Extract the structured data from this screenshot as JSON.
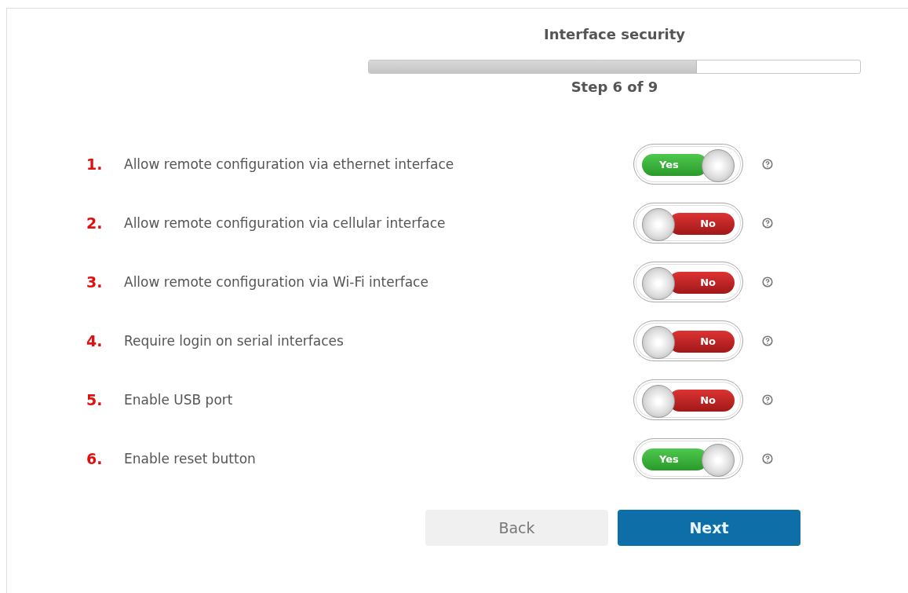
{
  "wizard": {
    "title": "Interface security",
    "progress": {
      "level": 0.667
    },
    "step": "Step 6 of 9"
  },
  "settings": [
    {
      "number": "1.",
      "label": "Allow remote configuration via ethernet interface",
      "on": true,
      "switch_text": "Yes"
    },
    {
      "number": "2.",
      "label": "Allow remote configuration via cellular interface",
      "on": false,
      "switch_text": "No"
    },
    {
      "number": "3.",
      "label": "Allow remote configuration via Wi-Fi interface",
      "on": false,
      "switch_text": "No"
    },
    {
      "number": "4.",
      "label": "Require login on serial interfaces",
      "on": false,
      "switch_text": "No"
    },
    {
      "number": "5.",
      "label": "Enable USB port",
      "on": false,
      "switch_text": "No"
    },
    {
      "number": "6.",
      "label": "Enable reset button",
      "on": true,
      "switch_text": "Yes"
    }
  ],
  "buttons": [
    {
      "label": "Back",
      "kind": "secondary"
    },
    {
      "label": "Next",
      "kind": "primary"
    }
  ]
}
